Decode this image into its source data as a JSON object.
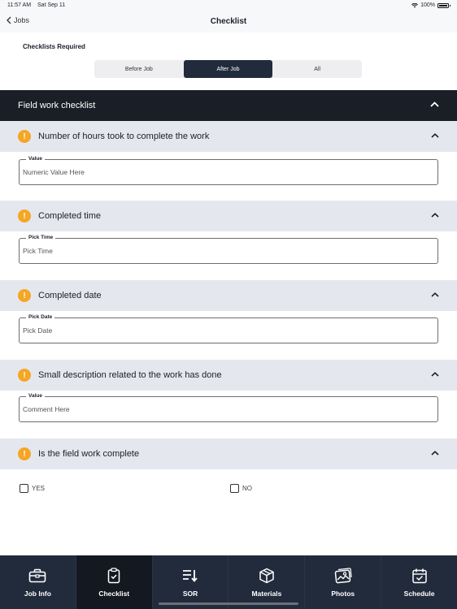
{
  "status_bar": {
    "time": "11:57 AM",
    "date": "Sat Sep 11",
    "battery": "100%"
  },
  "nav": {
    "back_label": "Jobs",
    "title": "Checklist"
  },
  "checklists_required": {
    "label": "Checklists Required",
    "segments": [
      {
        "label": "Before Job",
        "active": false
      },
      {
        "label": "After Job",
        "active": true
      },
      {
        "label": "All",
        "active": false
      }
    ]
  },
  "section": {
    "title": "Field work checklist",
    "expanded": true
  },
  "questions": [
    {
      "title": "Number of hours took to complete the work",
      "status": "warning",
      "field_label": "Value",
      "placeholder": "Numeric Value Here",
      "value": ""
    },
    {
      "title": "Completed time",
      "status": "warning",
      "field_label": "Pick Time",
      "placeholder": "Pick Time",
      "value": ""
    },
    {
      "title": "Completed date",
      "status": "warning",
      "field_label": "Pick Date",
      "placeholder": "Pick Date",
      "value": ""
    },
    {
      "title": "Small description related to the work has done",
      "status": "warning",
      "field_label": "Value",
      "placeholder": "Comment Here",
      "value": ""
    },
    {
      "title": "Is the field work complete",
      "status": "warning",
      "options": [
        {
          "label": "YES",
          "checked": false
        },
        {
          "label": "NO",
          "checked": false
        }
      ]
    }
  ],
  "tabs": [
    {
      "label": "Job Info",
      "icon": "briefcase-icon",
      "active": false
    },
    {
      "label": "Checklist",
      "icon": "clipboard-check-icon",
      "active": true
    },
    {
      "label": "SOR",
      "icon": "sort-list-icon",
      "active": false
    },
    {
      "label": "Materials",
      "icon": "box-icon",
      "active": false
    },
    {
      "label": "Photos",
      "icon": "photos-icon",
      "active": false
    },
    {
      "label": "Schedule",
      "icon": "calendar-check-icon",
      "active": false
    }
  ],
  "colors": {
    "accent_dark": "#212b3c",
    "section_header": "#1a1e27",
    "warning": "#f5a623",
    "question_bg": "#e5e7ee"
  }
}
